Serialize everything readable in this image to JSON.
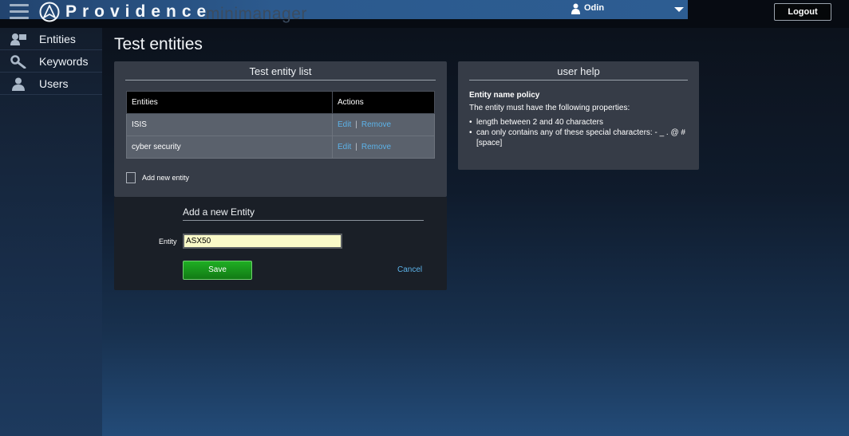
{
  "header": {
    "brand": "Providence",
    "subbrand": "minimanager",
    "user_name": "Odin",
    "logout_label": "Logout"
  },
  "sidebar": {
    "items": [
      {
        "label": "Entities",
        "icon": "entities-icon"
      },
      {
        "label": "Keywords",
        "icon": "keywords-icon"
      },
      {
        "label": "Users",
        "icon": "users-icon"
      }
    ]
  },
  "main": {
    "page_title": "Test entities",
    "list_panel": {
      "title": "Test entity list",
      "columns": [
        "Entities",
        "Actions"
      ],
      "rows": [
        {
          "entity": "ISIS",
          "edit": "Edit",
          "remove": "Remove"
        },
        {
          "entity": "cyber security",
          "edit": "Edit",
          "remove": "Remove"
        }
      ],
      "action_separator": "|",
      "add_new_label": "Add new entity"
    },
    "form": {
      "title": "Add a new Entity",
      "entity_label": "Entity",
      "entity_value": "ASX50",
      "save_label": "Save",
      "cancel_label": "Cancel"
    },
    "help": {
      "title": "user help",
      "heading": "Entity name policy",
      "intro": "The entity must have the following properties:",
      "rules": [
        "length between 2 and 40 characters",
        "can only contains any of these special characters: - _ . @ # [space]"
      ]
    }
  },
  "colors": {
    "accent_link": "#5cb2e8",
    "save_green": "#1fae23",
    "input_bg": "#fafac8"
  }
}
